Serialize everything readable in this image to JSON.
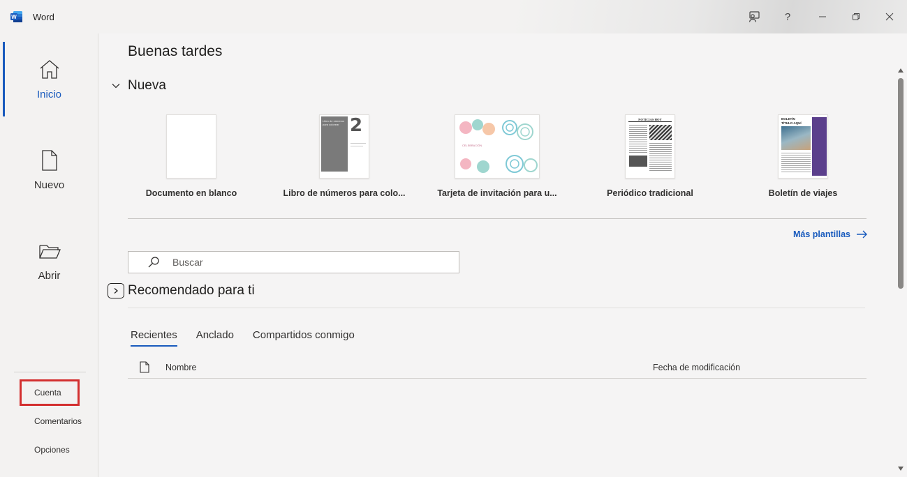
{
  "app": {
    "title": "Word"
  },
  "window_controls": {
    "feedback_icon": "feedback-icon",
    "help_label": "?",
    "minimize_icon": "minimize-icon",
    "restore_icon": "restore-icon",
    "close_icon": "close-icon"
  },
  "nav": {
    "items": [
      {
        "label": "Inicio",
        "icon": "home-icon",
        "active": true
      },
      {
        "label": "Nuevo",
        "icon": "new-document-icon",
        "active": false
      },
      {
        "label": "Abrir",
        "icon": "folder-open-icon",
        "active": false
      }
    ],
    "bottom_links": [
      "Cuenta",
      "Comentarios",
      "Opciones"
    ],
    "highlighted_link": "Cuenta"
  },
  "main": {
    "greeting": "Buenas tardes",
    "new_section_title": "Nueva",
    "templates": [
      {
        "label": "Documento en blanco"
      },
      {
        "label": "Libro de números para colo...",
        "thumb_number": "2",
        "thumb_text": "Libro de números para colorear"
      },
      {
        "label": "Tarjeta de invitación para u...",
        "thumb_caption": "CELEBRACIÓN"
      },
      {
        "label": "Periódico tradicional",
        "thumb_header": "NOTICIAS HOY"
      },
      {
        "label": "Boletín de viajes",
        "thumb_title_1": "BOLETÍN",
        "thumb_title_2": "TÍTULO AQUÍ"
      }
    ],
    "more_templates": "Más plantillas",
    "search": {
      "placeholder": "Buscar",
      "value": ""
    },
    "recommended_title": "Recomendado para ti",
    "tabs": [
      {
        "label": "Recientes",
        "active": true
      },
      {
        "label": "Anclado",
        "active": false
      },
      {
        "label": "Compartidos conmigo",
        "active": false
      }
    ],
    "columns": {
      "name": "Nombre",
      "modified": "Fecha de modificación"
    }
  },
  "colors": {
    "accent": "#185abd",
    "highlight_box": "#d32f2f",
    "word_brand": "#185abd"
  }
}
